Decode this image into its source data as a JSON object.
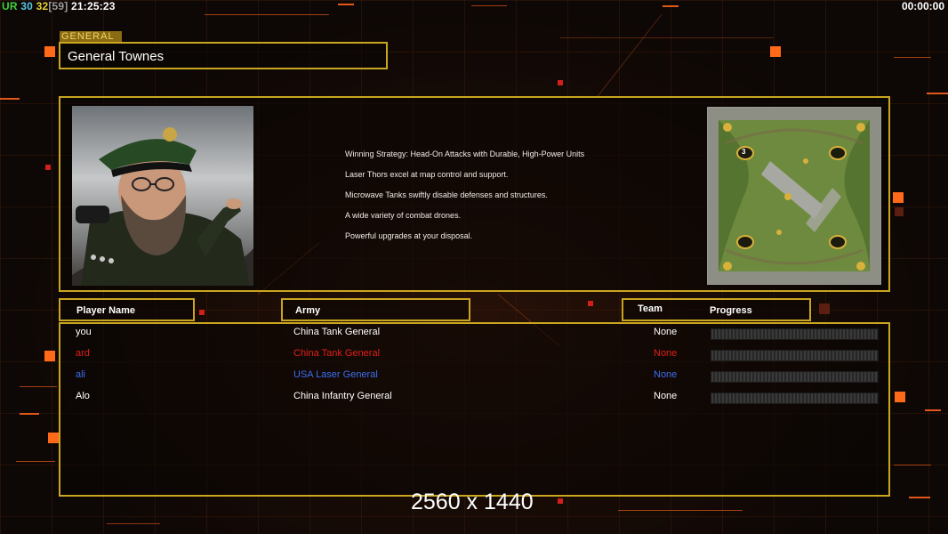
{
  "hud": {
    "ur_label": "UR",
    "fps_a": "30",
    "fps_b": "32",
    "fps_c": "[59]",
    "clock": "21:25:23",
    "timer": "00:00:00"
  },
  "general": {
    "tag": "GENERAL",
    "name": "General Townes"
  },
  "strategy": [
    "Winning Strategy: Head-On Attacks with Durable, High-Power Units",
    "Laser Thors excel at map control and support.",
    "Microwave Tanks swiftly disable defenses and structures.",
    "A wide variety of combat drones.",
    "Powerful upgrades at your disposal."
  ],
  "minimap": {
    "start_label": "3"
  },
  "headers": {
    "player_name": "Player Name",
    "army": "Army",
    "team": "Team",
    "progress": "Progress"
  },
  "players": [
    {
      "name": "you",
      "army": "China Tank General",
      "team": "None",
      "color": "#ffffff",
      "progress": 0
    },
    {
      "name": "ard",
      "army": "China Tank General",
      "team": "None",
      "color": "#e0201a",
      "progress": 0
    },
    {
      "name": "ali",
      "army": "USA Laser General",
      "team": "None",
      "color": "#3c6ff0",
      "progress": 0
    },
    {
      "name": "Alo",
      "army": "China Infantry General",
      "team": "None",
      "color": "#ffffff",
      "progress": 0
    }
  ],
  "resolution": "2560 x 1440",
  "colors": {
    "frame": "#c9a520",
    "accent": "#ff6a1a",
    "ur_green": "#3fd13f",
    "fps_cyan": "#54c8e6",
    "fps_yellow": "#e7d43a",
    "fps_grey": "#9a9a9a"
  }
}
